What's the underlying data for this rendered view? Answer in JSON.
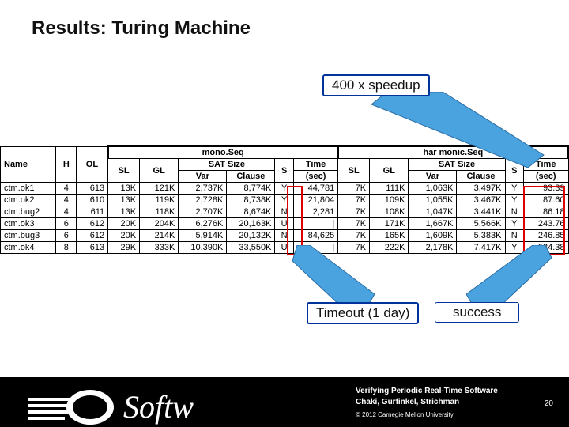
{
  "title": "Results: Turing Machine",
  "callouts": {
    "speedup": "400 x speedup",
    "timeout": "Timeout (1 day)",
    "success": "success"
  },
  "table": {
    "group1": "mono.Seq",
    "group2": "har monic.Seq",
    "cols": {
      "name": "Name",
      "h": "H",
      "ol": "OL",
      "sl": "SL",
      "gl": "GL",
      "sat": "SAT Size",
      "var": "Var",
      "clause": "Clause",
      "s": "S",
      "time": "Time",
      "time_unit": "(sec)"
    },
    "rows": [
      {
        "name": "ctm.ok1",
        "h": "4",
        "ol": "613",
        "sl": "13K",
        "gl": "121K",
        "var": "2,737K",
        "cla": "8,774K",
        "s": "Y",
        "time": "44,781",
        "sl2": "7K",
        "gl2": "111K",
        "var2": "1,063K",
        "cla2": "3,497K",
        "s2": "Y",
        "time2": "93.39"
      },
      {
        "name": "ctm.ok2",
        "h": "4",
        "ol": "610",
        "sl": "13K",
        "gl": "119K",
        "var": "2,728K",
        "cla": "8,738K",
        "s": "Y",
        "time": "21,804",
        "sl2": "7K",
        "gl2": "109K",
        "var2": "1,055K",
        "cla2": "3,467K",
        "s2": "Y",
        "time2": "87.60"
      },
      {
        "name": "ctm.bug2",
        "h": "4",
        "ol": "611",
        "sl": "13K",
        "gl": "118K",
        "var": "2,707K",
        "cla": "8,674K",
        "s": "N",
        "time": "2,281",
        "sl2": "7K",
        "gl2": "108K",
        "var2": "1,047K",
        "cla2": "3,441K",
        "s2": "N",
        "time2": "86.18"
      },
      {
        "name": "ctm.ok3",
        "h": "6",
        "ol": "612",
        "sl": "20K",
        "gl": "204K",
        "var": "6,276K",
        "cla": "20,163K",
        "s": "U",
        "time": "|",
        "sl2": "7K",
        "gl2": "171K",
        "var2": "1,667K",
        "cla2": "5,566K",
        "s2": "Y",
        "time2": "243.76"
      },
      {
        "name": "ctm.bug3",
        "h": "6",
        "ol": "612",
        "sl": "20K",
        "gl": "214K",
        "var": "5,914K",
        "cla": "20,132K",
        "s": "N",
        "time": "84,625",
        "sl2": "7K",
        "gl2": "165K",
        "var2": "1,609K",
        "cla2": "5,383K",
        "s2": "N",
        "time2": "246.85"
      },
      {
        "name": "ctm.ok4",
        "h": "8",
        "ol": "613",
        "sl": "29K",
        "gl": "333K",
        "var": "10,390K",
        "cla": "33,550K",
        "s": "U",
        "time": "|",
        "sl2": "7K",
        "gl2": "222K",
        "var2": "2,178K",
        "cla2": "7,417K",
        "s2": "Y",
        "time2": "534.38"
      }
    ]
  },
  "footer": {
    "line1": "Verifying Periodic Real-Time Software",
    "line2": "Chaki, Gurfinkel, Strichman",
    "copyright": "© 2012 Carnegie Mellon University",
    "page": "20",
    "logo_text": "Softw"
  }
}
